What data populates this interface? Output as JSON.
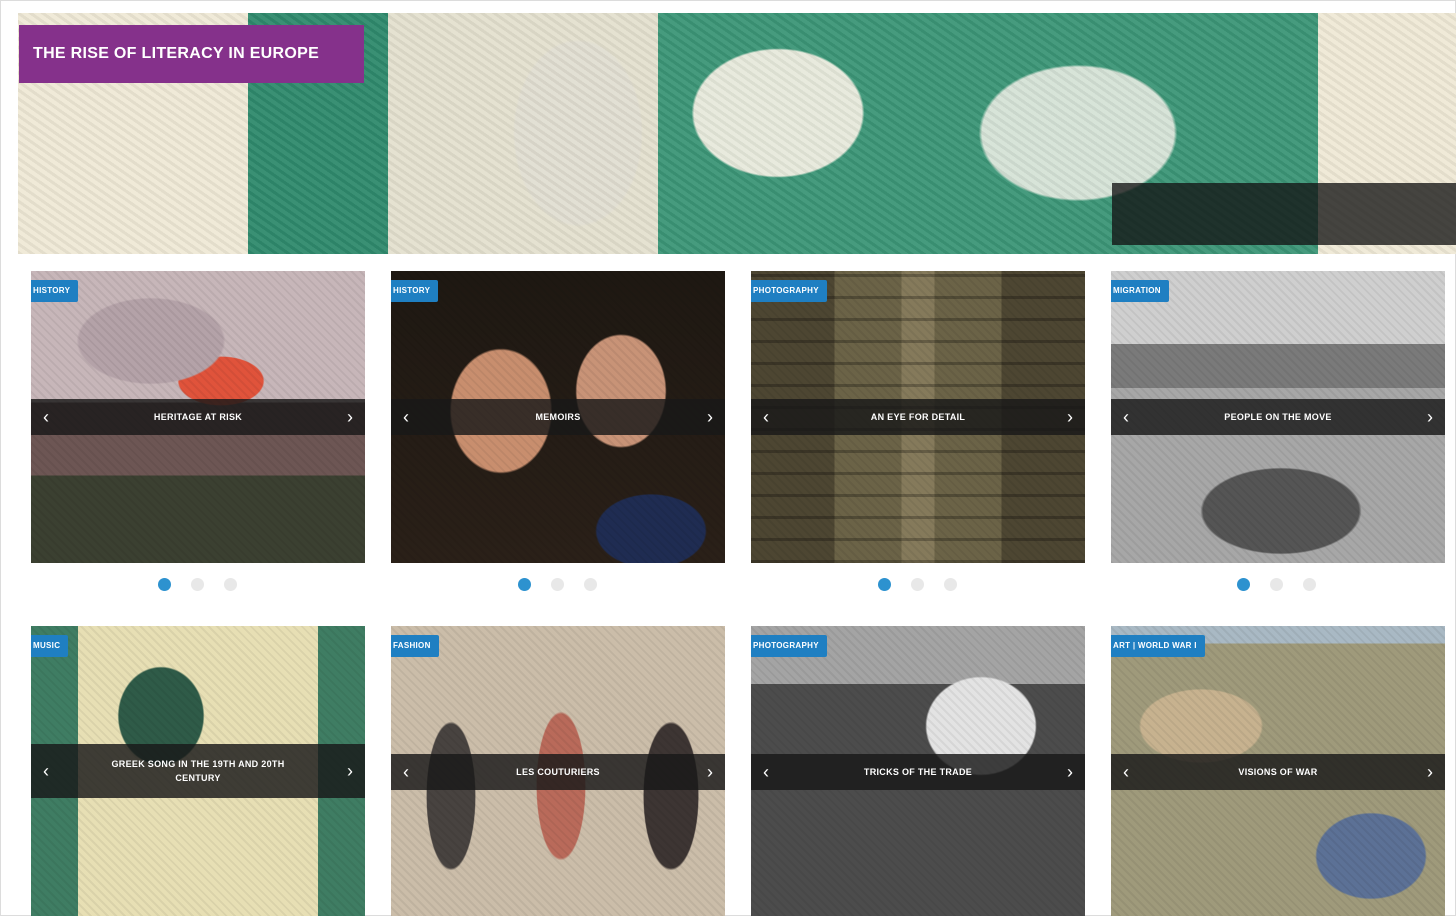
{
  "hero": {
    "title": "THE RISE OF LITERACY IN EUROPE",
    "caption_lines": [
      "",
      "",
      "",
      ""
    ]
  },
  "row1": [
    {
      "tag": "HISTORY",
      "title": "HERITAGE AT RISK",
      "slides": 3,
      "active": 0
    },
    {
      "tag": "HISTORY",
      "title": "MEMOIRS",
      "slides": 3,
      "active": 0
    },
    {
      "tag": "PHOTOGRAPHY",
      "title": "AN EYE FOR DETAIL",
      "slides": 3,
      "active": 0
    },
    {
      "tag": "MIGRATION",
      "title": "PEOPLE ON THE MOVE",
      "slides": 3,
      "active": 0
    }
  ],
  "row2": [
    {
      "tag": "MUSIC",
      "title": "GREEK SONG IN THE 19TH AND 20TH CENTURY"
    },
    {
      "tag": "FASHION",
      "title": "LES COUTURIERS"
    },
    {
      "tag": "PHOTOGRAPHY",
      "title": "TRICKS OF THE TRADE"
    },
    {
      "tag": "ART | WORLD WAR I",
      "title": "VISIONS OF WAR"
    }
  ],
  "icons": {
    "prev": "chevron-left-icon",
    "next": "chevron-right-icon"
  },
  "colors": {
    "title_bg": "#85318b",
    "tag_bg": "#1f7fc2",
    "dot_active": "#2d92cf",
    "dot_inactive": "#e8e8e8"
  },
  "arrows": {
    "prev": "‹",
    "next": "›"
  }
}
